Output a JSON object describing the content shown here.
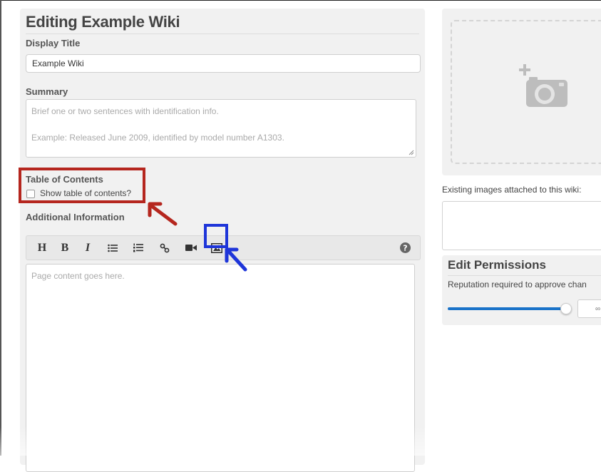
{
  "editor": {
    "heading": "Editing Example Wiki",
    "display_title_label": "Display Title",
    "display_title_value": "Example Wiki",
    "summary_label": "Summary",
    "summary_placeholder_line1": "Brief one or two sentences with identification info.",
    "summary_placeholder_line2": "Example: Released June 2009, identified by model number A1303.",
    "toc_label": "Table of Contents",
    "toc_checkbox_label": "Show table of contents?",
    "toc_checked": false,
    "additional_info_label": "Additional Information",
    "toolbar": {
      "heading": "H",
      "bold": "B",
      "italic": "I",
      "bulleted_list_icon": "bulleted-list-icon",
      "numbered_list_icon": "numbered-list-icon",
      "link_icon": "link-icon",
      "video_icon": "video-camera-icon",
      "image_icon": "image-icon",
      "help_icon": "help-icon"
    },
    "content_placeholder": "Page content goes here."
  },
  "sidebar": {
    "add_photo_icon": "add-camera-icon",
    "existing_images_label": "Existing images attached to this wiki:",
    "permissions": {
      "title": "Edit Permissions",
      "reputation_label": "Reputation required to approve chan",
      "slider_level": 1.0,
      "value": "∞"
    }
  },
  "annotations": {
    "red_highlight": "table-of-contents",
    "blue_highlight": "image-button",
    "red_color": "#b5261e",
    "blue_color": "#1e35d9"
  },
  "colors": {
    "panel_bg": "#f1f1f1",
    "accent_blue": "#1a73c9"
  }
}
